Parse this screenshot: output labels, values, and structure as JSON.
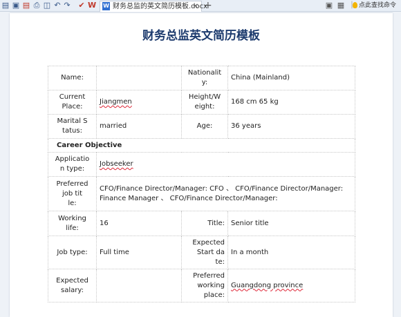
{
  "toolbar": {
    "icons": [
      "open-folder-icon",
      "save-icon",
      "export-pdf-icon",
      "print-icon",
      "print-preview-icon",
      "undo-icon",
      "redo-icon",
      "format-painter-icon",
      "wps-icon"
    ],
    "tab_title": "财务总监的英文简历模板.docx",
    "new_tab": "+",
    "assist_text": "点此查找命令"
  },
  "document": {
    "title": "财务总监英文简历模板",
    "rows": {
      "name_label": "Name:",
      "name_value": "",
      "nationality_label": "Nationality:",
      "nationality_value": "China (Mainland)",
      "place_label": "Current Place:",
      "place_value": "Jiangmen",
      "hw_label": "Height/Weight:",
      "hw_value": "168 cm   65 kg",
      "marital_label": "Marital Status:",
      "marital_value": "married",
      "age_label": "Age:",
      "age_value": "36 years",
      "section_career": "Career Objective",
      "apptype_label": "Application type:",
      "apptype_value": "Jobseeker",
      "pref_title_label": "Preferred job title:",
      "pref_title_value": "CFO/Finance Director/Manager: CFO 、 CFO/Finance Director/Manager: Finance Manager 、 CFO/Finance Director/Manager:",
      "working_life_label": "Working life:",
      "working_life_value": "16",
      "title_label": "Title:",
      "title_value": "Senior title",
      "jobtype_label": "Job type:",
      "jobtype_value": "Full time",
      "start_label": "Expected Start date:",
      "start_value": "In a month",
      "salary_label": "Expected salary:",
      "salary_value": "",
      "place_pref_label": "Preferred working place:",
      "place_pref_value": "Guangdong province"
    }
  }
}
